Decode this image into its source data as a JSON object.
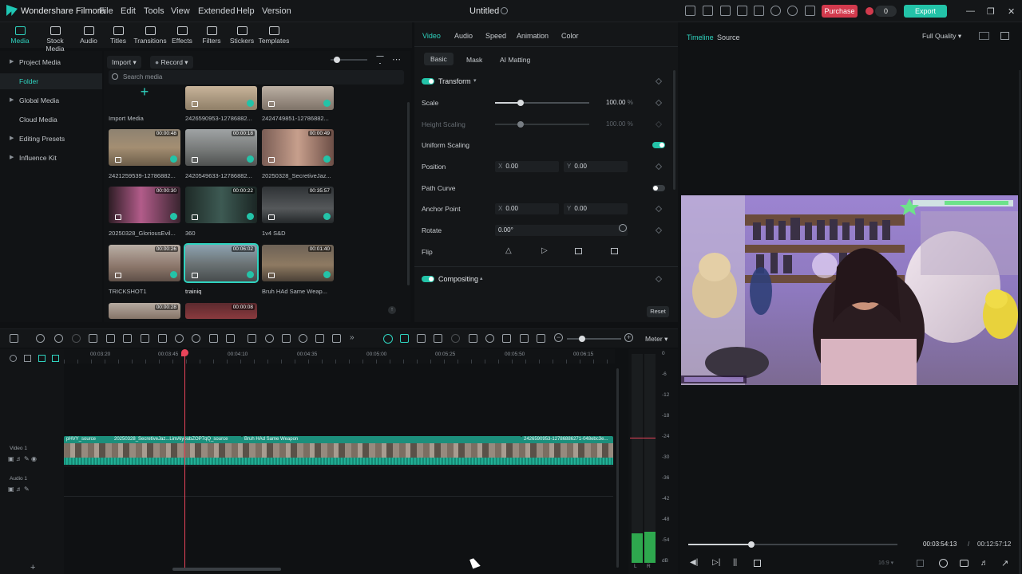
{
  "app": {
    "name": "Wondershare Filmora",
    "menu": [
      "File",
      "Edit",
      "Tools",
      "View",
      "Extended",
      "Help",
      "Version"
    ],
    "document_title": "Untitled",
    "purchase_label": "Purchase",
    "credits": "0",
    "export_label": "Export",
    "accent": "#23c3a8"
  },
  "media_tabs": [
    {
      "label": "Media",
      "icon": "media-icon",
      "active": true
    },
    {
      "label": "Stock Media",
      "icon": "stock-media-icon",
      "active": false
    },
    {
      "label": "Audio",
      "icon": "audio-icon",
      "active": false
    },
    {
      "label": "Titles",
      "icon": "titles-icon",
      "active": false
    },
    {
      "label": "Transitions",
      "icon": "transitions-icon",
      "active": false
    },
    {
      "label": "Effects",
      "icon": "effects-icon",
      "active": false
    },
    {
      "label": "Filters",
      "icon": "filters-icon",
      "active": false
    },
    {
      "label": "Stickers",
      "icon": "stickers-icon",
      "active": false
    },
    {
      "label": "Templates",
      "icon": "templates-icon",
      "active": false
    }
  ],
  "tree": [
    {
      "label": "Project Media",
      "caret": true
    },
    {
      "label": "Folder",
      "selected": true
    },
    {
      "label": "Global Media",
      "caret": true
    },
    {
      "label": "Cloud Media"
    },
    {
      "label": "Editing Presets",
      "caret": true
    },
    {
      "label": "Influence Kit",
      "caret": true
    }
  ],
  "media_toolbar": {
    "import_label": "Import",
    "record_label": "Record",
    "search_placeholder": "Search media"
  },
  "media_items": [
    {
      "label": "Import Media",
      "duration": "",
      "kind": "import"
    },
    {
      "label": "2426590953-12786882...",
      "duration": ""
    },
    {
      "label": "2424749851-12786882...",
      "duration": ""
    },
    {
      "label": "2421259539-12786882...",
      "duration": "00:00:48"
    },
    {
      "label": "2420549633-12786882...",
      "duration": "00:00:18"
    },
    {
      "label": "20250328_SecretiveJaz...",
      "duration": "00:00:49"
    },
    {
      "label": "20250328_GloriousEvil...",
      "duration": "00:00:30"
    },
    {
      "label": "360",
      "duration": "00:00:22"
    },
    {
      "label": "1v4 S&D",
      "duration": "00:35:57"
    },
    {
      "label": "TRICKSHOT1",
      "duration": "00:00:26"
    },
    {
      "label": "trainiq",
      "duration": "00:06:02",
      "selected": true
    },
    {
      "label": "Bruh HAd Same Weap...",
      "duration": "00:01:40"
    },
    {
      "label": "",
      "duration": "00:00:28"
    },
    {
      "label": "",
      "duration": "00:00:08"
    }
  ],
  "props": {
    "tabs": [
      "Video",
      "Audio",
      "Speed",
      "Animation",
      "Color"
    ],
    "subtabs": [
      "Basic",
      "Mask",
      "AI Matting"
    ],
    "transform_label": "Transform",
    "scale_label": "Scale",
    "scale_value": "100.00",
    "scale_unit": "%",
    "height_scaling_label": "Height Scaling",
    "height_scaling_value": "100.00",
    "uniform_scaling_label": "Uniform Scaling",
    "position_label": "Position",
    "position_x": "0.00",
    "position_y": "0.00",
    "path_curve_label": "Path Curve",
    "anchor_label": "Anchor Point",
    "anchor_x": "0.00",
    "anchor_y": "0.00",
    "rotate_label": "Rotate",
    "rotate_value": "0.00°",
    "flip_label": "Flip",
    "compositing_label": "Compositing",
    "reset_label": "Reset",
    "axis_x": "X",
    "axis_y": "Y"
  },
  "preview": {
    "timeline_label": "Timeline",
    "source_label": "Source",
    "quality": "Full Quality",
    "current_time": "00:03:54:13",
    "separator": "/",
    "total_time": "00:12:57:12",
    "ratio": "16:9",
    "progress": 0.3
  },
  "timeline": {
    "ruler": [
      "00:03:20",
      "00:03:45",
      "00:04:10",
      "00:04:35",
      "00:05:00",
      "00:05:25",
      "00:05:50",
      "00:06:15"
    ],
    "video_track_label": "Video 1",
    "audio_track_label": "Audio 1",
    "clips": [
      {
        "name": "pHVY_source"
      },
      {
        "name": "20250328_SecretiveJaz...LimAlyoubZOP7qQ_source"
      },
      {
        "name": "Bruh HAd Same Weapon"
      },
      {
        "name": "2426590953-12786886271-048ebc3e..."
      }
    ],
    "meter_label": "Meter",
    "meter_scale": [
      "0",
      "-6",
      "-12",
      "-18",
      "-24",
      "-30",
      "-36",
      "-42",
      "-48",
      "-54",
      "dB"
    ],
    "meter_channels": [
      "L",
      "R"
    ]
  }
}
